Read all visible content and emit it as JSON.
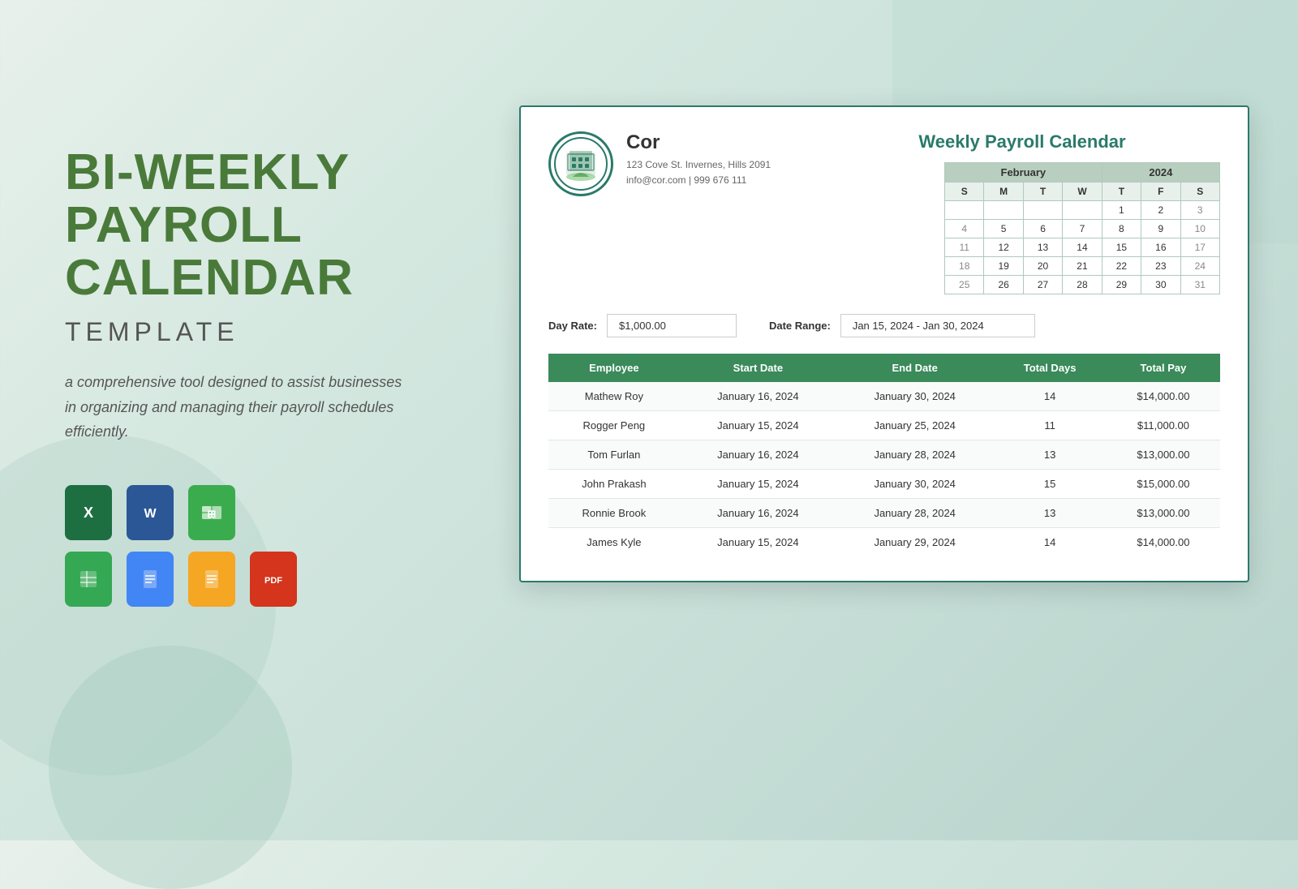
{
  "background": {
    "color": "#d4e8e0"
  },
  "left": {
    "main_title": "BI-WEEKLY\nPAYROLL\nCALENDAR",
    "sub_title": "TEMPLATE",
    "description": "a comprehensive tool designed to assist businesses in organizing and managing their payroll schedules efficiently.",
    "formats": {
      "row1": [
        "Excel",
        "Word",
        "Numbers"
      ],
      "row2": [
        "Google Sheets",
        "Google Docs",
        "Pages",
        "PDF"
      ]
    }
  },
  "document": {
    "company": {
      "name": "Cor",
      "address": "123 Cove St. Invernes, Hills 2091",
      "contact": "info@cor.com | 999 676 111"
    },
    "calendar_title": "Weekly Payroll Calendar",
    "calendar": {
      "month1": "February",
      "year": "2024",
      "day_headers": [
        "S",
        "M",
        "T",
        "W",
        "T",
        "F",
        "S"
      ],
      "weeks": [
        [
          "",
          "",
          "",
          "",
          "1",
          "2",
          "3"
        ],
        [
          "4",
          "5",
          "6",
          "7",
          "8",
          "9",
          "10"
        ],
        [
          "11",
          "12",
          "13",
          "14",
          "15",
          "16",
          "17"
        ],
        [
          "18",
          "19",
          "20",
          "21",
          "22",
          "23",
          "24"
        ],
        [
          "25",
          "26",
          "27",
          "28",
          "29",
          "30",
          "31"
        ]
      ]
    },
    "form": {
      "day_rate_label": "Day Rate:",
      "day_rate_value": "$1,000.00",
      "date_range_label": "Date Range:",
      "date_range_value": "Jan 15, 2024 - Jan 30, 2024"
    },
    "table": {
      "headers": [
        "Employee",
        "Start Date",
        "End Date",
        "Total Days",
        "Total Pay"
      ],
      "rows": [
        {
          "employee": "Mathew Roy",
          "start_date": "January 16, 2024",
          "end_date": "January 30, 2024",
          "total_days": "14",
          "total_pay": "$14,000.00"
        },
        {
          "employee": "Rogger Peng",
          "start_date": "January 15, 2024",
          "end_date": "January 25, 2024",
          "total_days": "11",
          "total_pay": "$11,000.00"
        },
        {
          "employee": "Tom Furlan",
          "start_date": "January 16, 2024",
          "end_date": "January 28, 2024",
          "total_days": "13",
          "total_pay": "$13,000.00"
        },
        {
          "employee": "John Prakash",
          "start_date": "January 15, 2024",
          "end_date": "January 30, 2024",
          "total_days": "15",
          "total_pay": "$15,000.00"
        },
        {
          "employee": "Ronnie Brook",
          "start_date": "January 16, 2024",
          "end_date": "January 28, 2024",
          "total_days": "13",
          "total_pay": "$13,000.00"
        },
        {
          "employee": "James Kyle",
          "start_date": "January 15, 2024",
          "end_date": "January 29, 2024",
          "total_days": "14",
          "total_pay": "$14,000.00"
        }
      ]
    }
  }
}
